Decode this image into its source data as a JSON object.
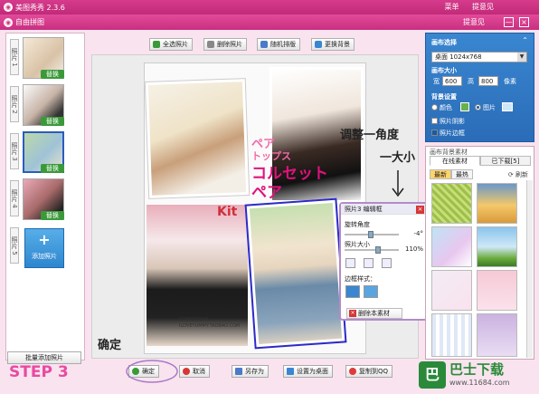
{
  "app": {
    "title": "美图秀秀 2.3.6",
    "menu": [
      "菜单",
      "提意见"
    ],
    "window_title": "自由拼图",
    "help_label": "提意见",
    "close_symbol": "×",
    "min_symbol": "—"
  },
  "left_panel": {
    "thumbs": [
      {
        "label": "照片 1",
        "badge": "替换"
      },
      {
        "label": "照片 2",
        "badge": "替换"
      },
      {
        "label": "照片 3",
        "badge": "替换"
      },
      {
        "label": "照片 4",
        "badge": "替换"
      },
      {
        "label": "照片 5",
        "badge": ""
      }
    ],
    "add_photo_label": "添加照片",
    "batch_add_label": "批量添加照片"
  },
  "toolbar": {
    "select_all": "全选照片",
    "delete_photo": "删除照片",
    "random_layout": "随机排版",
    "change_background": "更换背景"
  },
  "canvas": {
    "jp_line1": "ペア",
    "jp_line2": "トップス",
    "jp_line3": "コルセット",
    "jp_line4": "ペア",
    "banner_fragment": "Kit",
    "watermark_lines": [
      "YUMMYSHOP",
      "ILOVEYUMMY.TAOBAO.COM"
    ]
  },
  "edit_dialog": {
    "title": "照片3 编辑框",
    "rotate_label": "旋转角度",
    "rotate_value": "-4°",
    "size_label": "照片大小",
    "size_value": "110%",
    "border_label": "边框样式：",
    "delete_label": "删除本素材"
  },
  "canvas_settings": {
    "section_title": "画布选择",
    "canvas_value": "桌面  1024x768",
    "size_title": "画布大小",
    "width_label": "宽",
    "width_value": "600",
    "height_label": "高",
    "height_value": "800",
    "unit": "像素",
    "bg_title": "背景设置",
    "color_option": "颜色",
    "image_option": "图片",
    "shadow_label": "照片阴影",
    "border_label": "照片边框"
  },
  "material_panel": {
    "title": "画布背景素材",
    "tab_online": "在线素材",
    "tab_downloaded": "已下载[5]",
    "sub_new": "最新",
    "sub_hot": "最热",
    "refresh": "刷新"
  },
  "bottom_bar": {
    "ok": "确定",
    "cancel": "取消",
    "save_as": "另存为",
    "set_desktop": "设置为桌面",
    "copy_to_qq": "复制到QQ"
  },
  "annotations": {
    "step": "STEP 3",
    "adjust_angle": "调整一角度",
    "size_note": "一大小",
    "confirm_note": "确定"
  },
  "watermark_logo": {
    "mark": "巴",
    "name": "巴士下载",
    "url": "www.11684.com"
  },
  "colors": {
    "titlebar": "#c92f80",
    "panel_blue": "#2a6cb8",
    "step_pink": "#e84aa0",
    "dialog_border": "#b48ac8",
    "jp_text": "#e0127d"
  }
}
